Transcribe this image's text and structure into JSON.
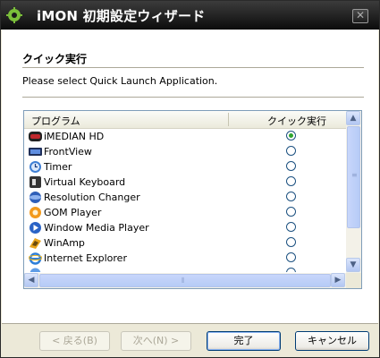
{
  "window": {
    "title": "iMON 初期設定ウィザード",
    "close_glyph": "✕",
    "accent_color": "#316ac5"
  },
  "section": {
    "title": "クイック実行",
    "instruction": "Please select Quick Launch Application."
  },
  "list": {
    "columns": [
      "プログラム",
      "クイック実行"
    ],
    "selected_index": 0,
    "items": [
      {
        "label": "iMEDIAN HD",
        "icon": "imedian-hd-icon",
        "selected": true
      },
      {
        "label": "FrontView",
        "icon": "frontview-icon",
        "selected": false
      },
      {
        "label": "Timer",
        "icon": "timer-icon",
        "selected": false
      },
      {
        "label": "Virtual Keyboard",
        "icon": "virtual-keyboard-icon",
        "selected": false
      },
      {
        "label": "Resolution Changer",
        "icon": "resolution-changer-icon",
        "selected": false
      },
      {
        "label": "GOM Player",
        "icon": "gom-player-icon",
        "selected": false
      },
      {
        "label": "Window Media Player",
        "icon": "windows-media-player-icon",
        "selected": false
      },
      {
        "label": "WinAmp",
        "icon": "winamp-icon",
        "selected": false
      },
      {
        "label": "Internet Explorer",
        "icon": "internet-explorer-icon",
        "selected": false
      }
    ]
  },
  "buttons": {
    "back": "< 戻る(B)",
    "next": "次へ(N) >",
    "finish": "完了",
    "cancel": "キャンセル"
  }
}
